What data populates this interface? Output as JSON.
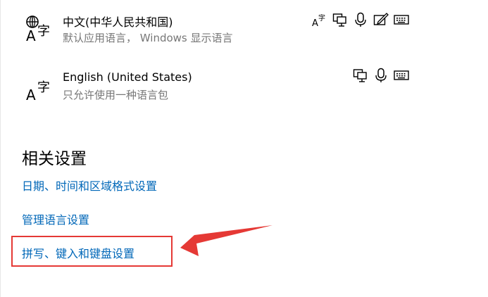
{
  "languages": [
    {
      "name": "中文(中华人民共和国)",
      "subtitle": "默认应用语言，  Windows 显示语言",
      "features": [
        "language-pack-icon",
        "text-to-speech-icon",
        "speech-recognition-icon",
        "handwriting-icon",
        "keyboard-icon"
      ]
    },
    {
      "name": "English (United States)",
      "subtitle": "只允许使用一种语言包",
      "features": [
        "text-to-speech-icon",
        "speech-recognition-icon",
        "keyboard-icon"
      ]
    }
  ],
  "related": {
    "title": "相关设置",
    "links": [
      "日期、时间和区域格式设置",
      "管理语言设置",
      "拼写、键入和键盘设置"
    ]
  },
  "colors": {
    "link": "#0067b8",
    "secondary_text": "#777777",
    "annotation": "#e53935"
  }
}
